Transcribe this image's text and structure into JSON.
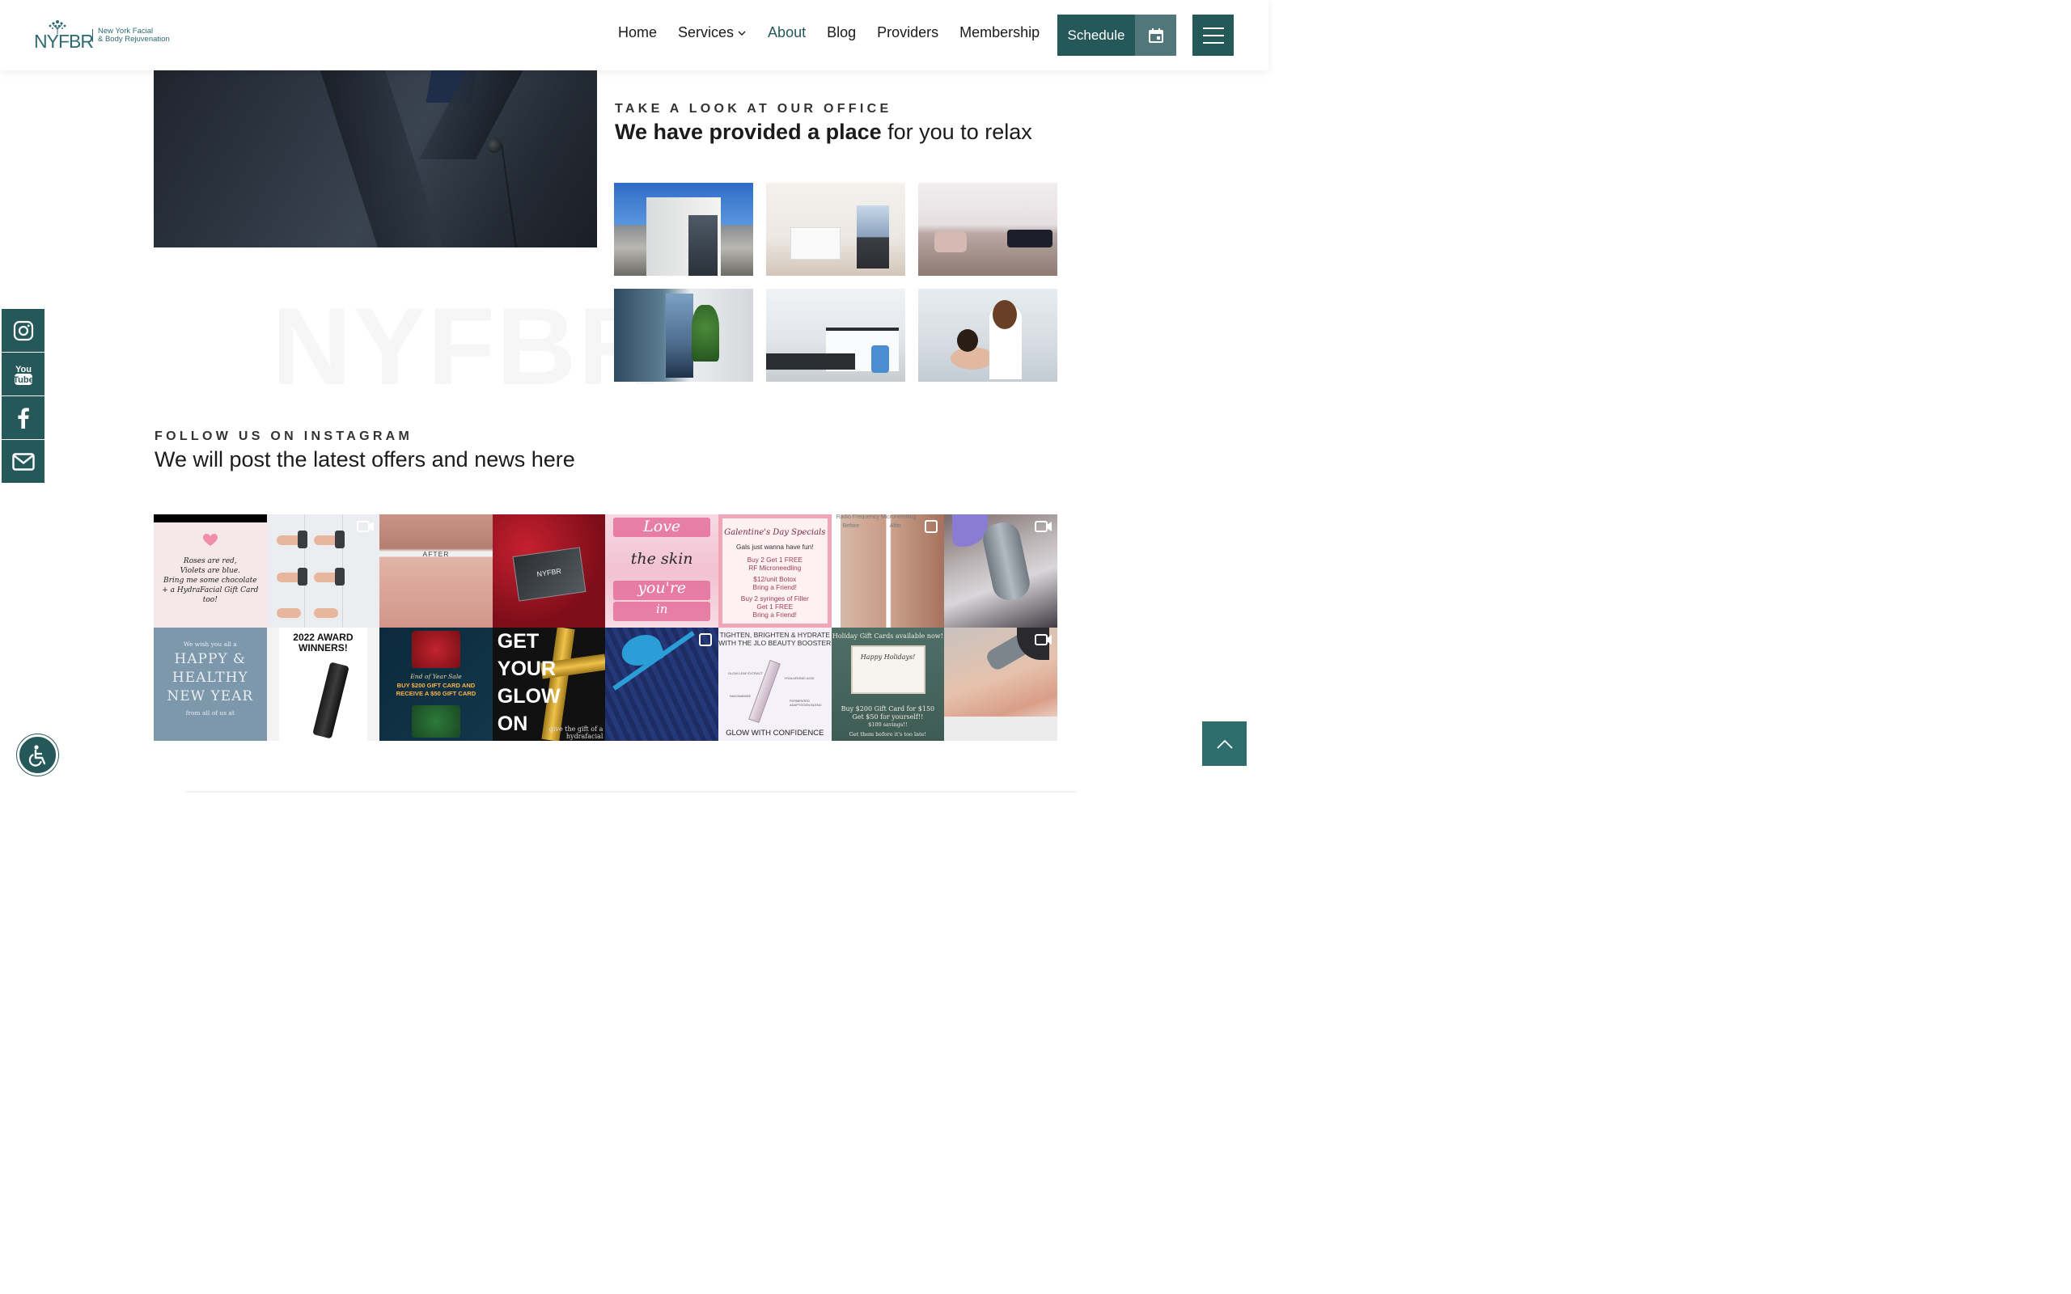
{
  "header": {
    "logo": {
      "letters": "NYFBR",
      "tagline_line1": "New York Facial",
      "tagline_line2": "& Body Rejuvenation"
    },
    "nav": [
      {
        "label": "Home",
        "active": false
      },
      {
        "label": "Services",
        "active": false,
        "has_dropdown": true
      },
      {
        "label": "About",
        "active": true
      },
      {
        "label": "Blog",
        "active": false
      },
      {
        "label": "Providers",
        "active": false
      },
      {
        "label": "Membership",
        "active": false
      }
    ],
    "schedule_label": "Schedule",
    "calendar_icon": "calendar-icon",
    "menu_icon": "hamburger-icon"
  },
  "watermark": "NYFBR",
  "office": {
    "eyebrow": "TAKE A LOOK AT OUR OFFICE",
    "title_bold": "We have provided a place",
    "title_rest": " for you to relax",
    "photos": [
      "building-exterior",
      "reception-desk",
      "lounge",
      "hallway-poster",
      "treatment-room",
      "provider-with-patient"
    ]
  },
  "instagram": {
    "eyebrow": "FOLLOW US ON INSTAGRAM",
    "title": "We will post the latest offers and news here",
    "tiles": {
      "t1": {
        "line1": "Roses are red,",
        "line2": "Violets are blue.",
        "line3": "Bring me some chocolate",
        "line4": "+ a HydraFacial Gift Card too!"
      },
      "t3": {
        "label": "AFTER"
      },
      "t4": {
        "card": "NYFBR"
      },
      "t5": {
        "w1": "Love",
        "w2": "the skin",
        "w3": "you're",
        "w4": "in"
      },
      "t6": {
        "header": "Galentine's Day Specials",
        "l1": "Gals just wanna have fun!",
        "l2": "Buy 2 Get 1 FREE",
        "l3": "RF Microneedling",
        "l4": "$12/unit Botox",
        "l5": "Bring a Friend!",
        "l6": "Buy 2 syringes of Filler",
        "l7": "Get 1 FREE",
        "l8": "Bring a Friend!"
      },
      "t7": {
        "caption": "Radio Frequency Microneedling",
        "before": "Before",
        "after": "After"
      },
      "t9": {
        "l1": "We wish you all a",
        "l2": "HAPPY &",
        "l3": "HEALTHY",
        "l4": "NEW YEAR",
        "l5": "from all of us at"
      },
      "t10": {
        "l1": "2022 AWARD",
        "l2": "WINNERS!"
      },
      "t11": {
        "sale": "End of Year Sale",
        "l1": "BUY $200 GIFT CARD AND",
        "l2": "RECEIVE A $50 GIFT CARD"
      },
      "t12": {
        "w1": "GET",
        "w2": "YOUR",
        "w3": "GLOW",
        "w4": "ON",
        "foot1": "give the gift of a",
        "foot2": "hydrafacial"
      },
      "t14": {
        "l1": "TIGHTEN, BRIGHTEN & HYDRATE",
        "l2": "WITH THE JLO BEAUTY BOOSTER",
        "a": "GLOW LEAF EXTRACT",
        "b": "HYALURONIC ACID",
        "c": "NIACINAMIDE",
        "d": "FERMENTED ADAPTOGEN BLEND",
        "foot": "GLOW WITH CONFIDENCE"
      },
      "t15": {
        "top": "Holiday Gift Cards available now!",
        "card": "Happy Holidays!",
        "l1": "Buy $200 Gift Card for $150",
        "l2": "Get $50 for yourself!!",
        "l3": "$100 savings!!",
        "l4": "Get them before it's too late!"
      }
    }
  },
  "social": [
    "instagram-icon",
    "youtube-icon",
    "facebook-icon",
    "mail-icon"
  ],
  "accent": "#255859"
}
